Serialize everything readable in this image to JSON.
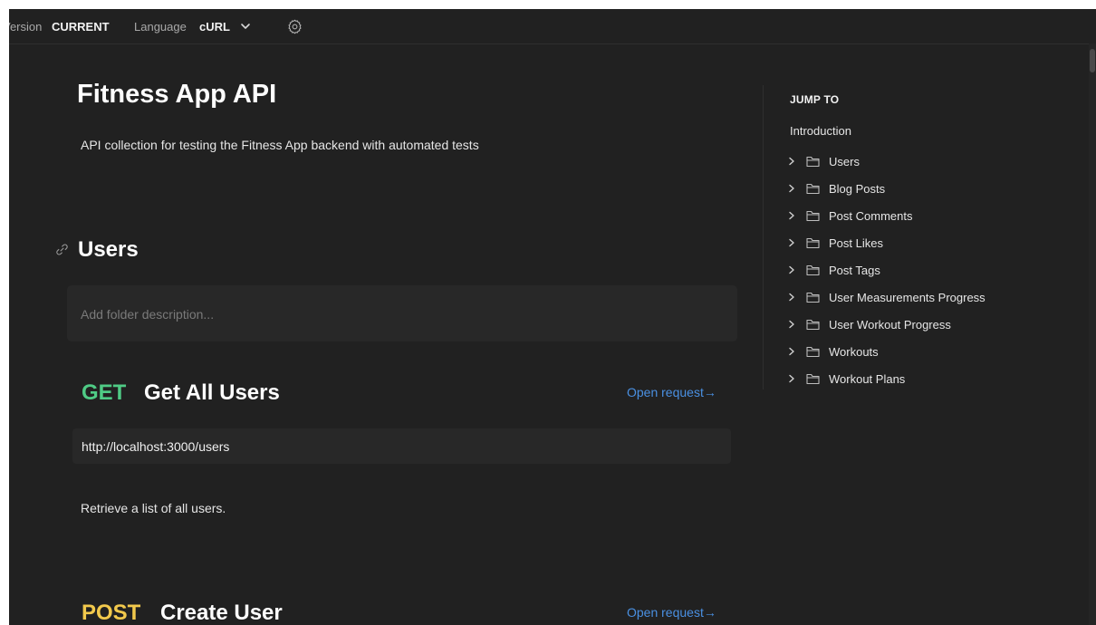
{
  "topbar": {
    "version_label": "Version",
    "version_value": "CURRENT",
    "language_label": "Language",
    "language_value": "cURL"
  },
  "doc": {
    "title": "Fitness App API",
    "description": "API collection for testing the Fitness App backend with automated tests"
  },
  "folder": {
    "title": "Users",
    "description_placeholder": "Add folder description..."
  },
  "requests": [
    {
      "method": "GET",
      "name": "Get All Users",
      "open_label": "Open request→",
      "url": "http://localhost:3000/users",
      "description": "Retrieve a list of all users."
    },
    {
      "method": "POST",
      "name": "Create User",
      "open_label": "Open request→"
    }
  ],
  "jump_to": {
    "heading": "JUMP TO",
    "introduction": "Introduction",
    "items": [
      {
        "label": "Users"
      },
      {
        "label": "Blog Posts"
      },
      {
        "label": "Post Comments"
      },
      {
        "label": "Post Likes"
      },
      {
        "label": "Post Tags"
      },
      {
        "label": "User Measurements Progress"
      },
      {
        "label": "User Workout Progress"
      },
      {
        "label": "Workouts"
      },
      {
        "label": "Workout Plans"
      }
    ]
  },
  "colors": {
    "background": "#212121",
    "get_method": "#4fcb85",
    "post_method": "#f2c94c",
    "link": "#4a90e2"
  },
  "icons": {
    "settings": "gear-icon",
    "language_dropdown": "chevron-down-icon",
    "section_link": "link-icon",
    "jump_expand": "chevron-right-icon",
    "jump_folder": "folder-icon"
  }
}
